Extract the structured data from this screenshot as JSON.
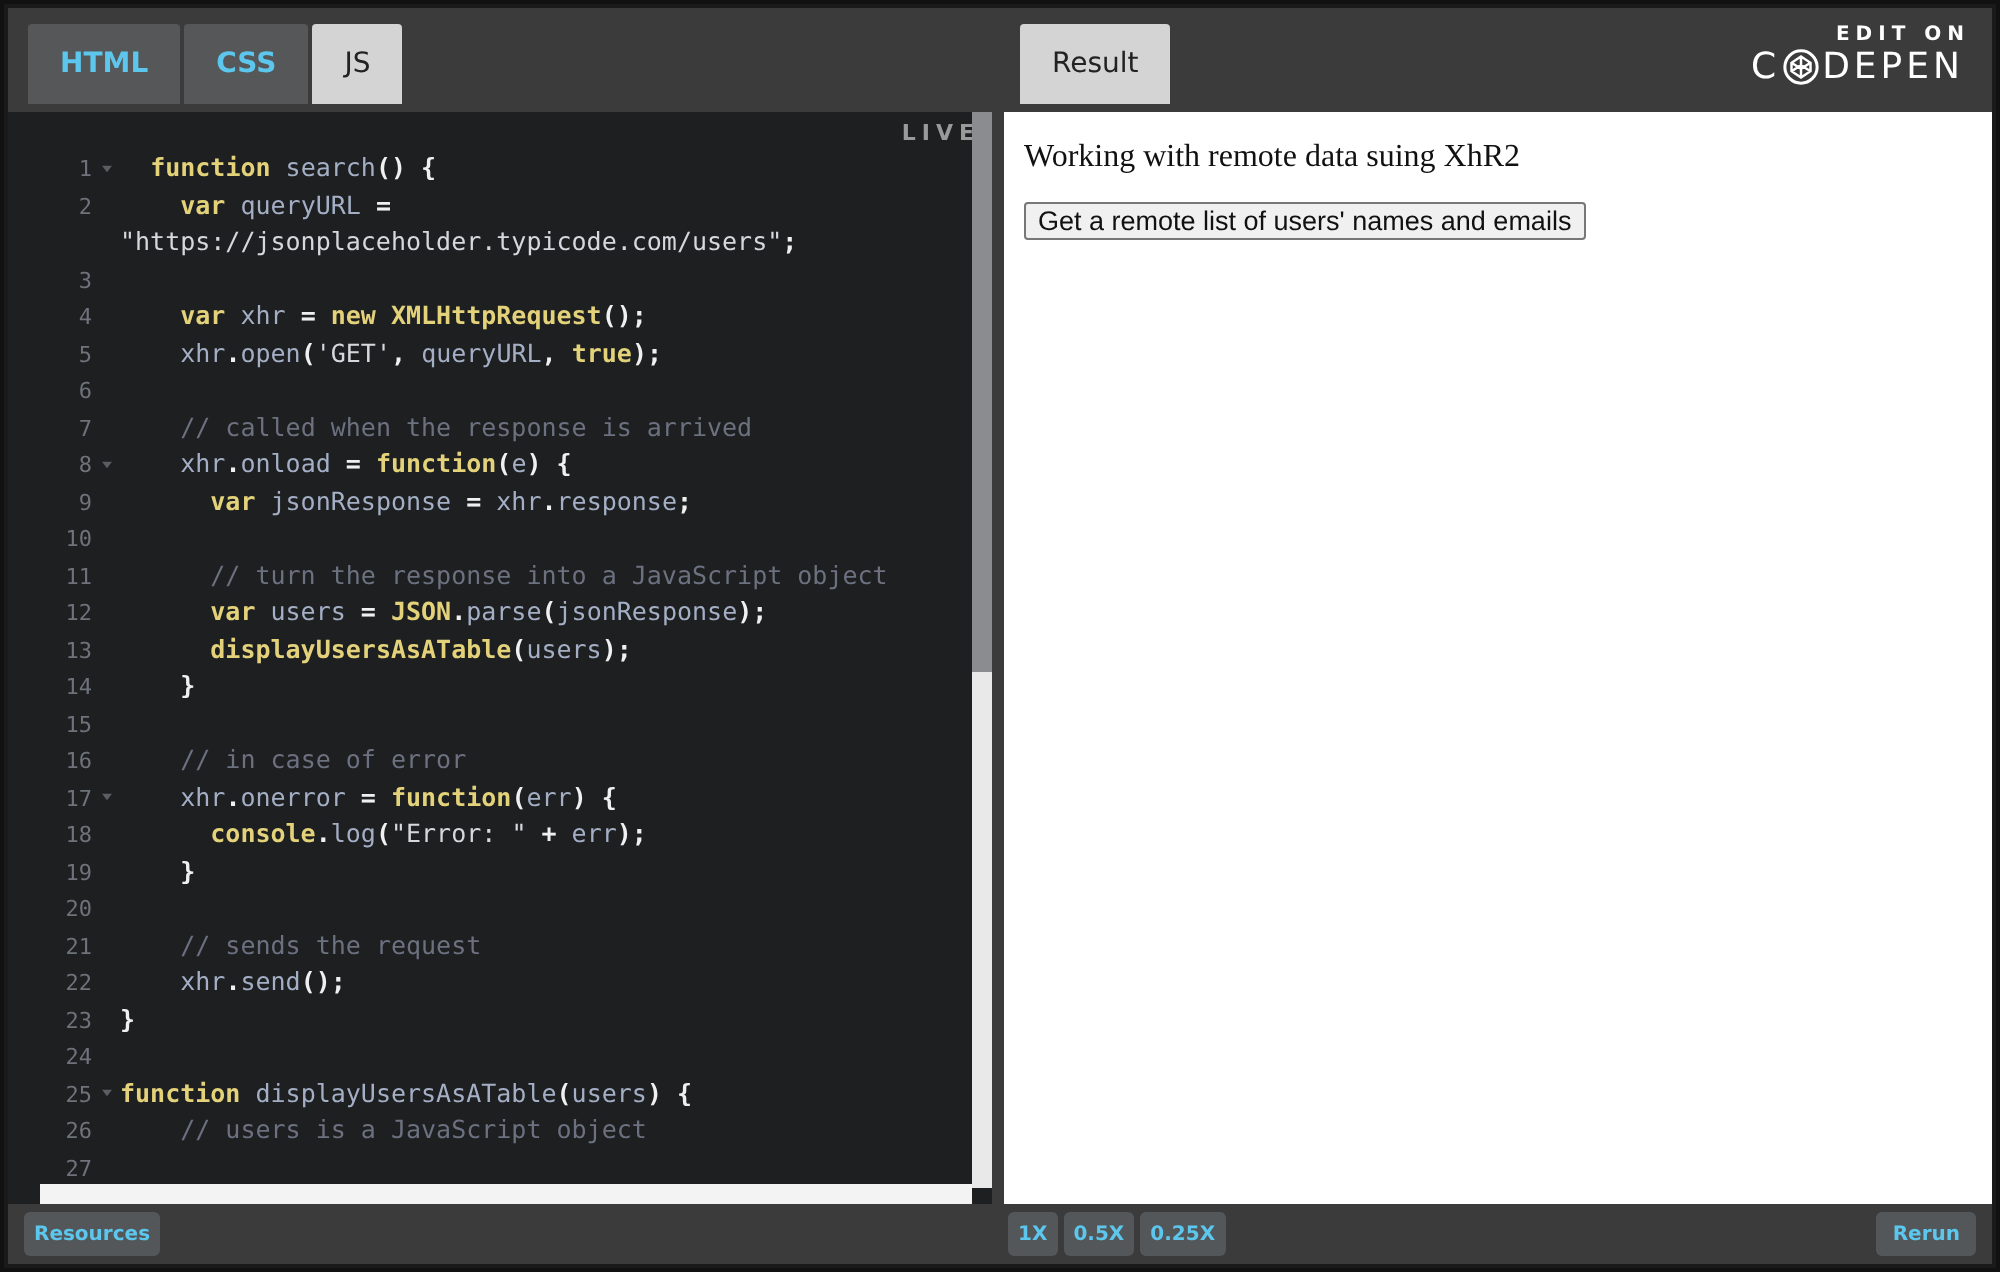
{
  "editor_tabs": [
    {
      "label": "HTML",
      "selected": false
    },
    {
      "label": "CSS",
      "selected": false
    },
    {
      "label": "JS",
      "selected": true
    }
  ],
  "live_badge": "LIVE",
  "code_lines": [
    {
      "number": "1",
      "fold": true,
      "tokens": [
        {
          "kind": "kw",
          "text": "  function"
        },
        {
          "kind": "id",
          "text": " search"
        },
        {
          "kind": "p",
          "text": "() {"
        }
      ]
    },
    {
      "number": "2",
      "fold": false,
      "tokens": [
        {
          "kind": "kw",
          "text": "    var"
        },
        {
          "kind": "id",
          "text": " queryURL"
        },
        {
          "kind": "p",
          "text": " ="
        }
      ]
    },
    {
      "fold": false,
      "tokens": [
        {
          "kind": "str",
          "text": "\"https://jsonplaceholder.typicode.com/users\""
        },
        {
          "kind": "p",
          "text": ";"
        }
      ]
    },
    {
      "number": "3",
      "fold": false
    },
    {
      "number": "4",
      "fold": false,
      "tokens": [
        {
          "kind": "kw",
          "text": "    var"
        },
        {
          "kind": "id",
          "text": " xhr"
        },
        {
          "kind": "p",
          "text": " = "
        },
        {
          "kind": "kw",
          "text": "new"
        },
        {
          "kind": "fn",
          "text": " XMLHttpRequest"
        },
        {
          "kind": "p",
          "text": "();"
        }
      ]
    },
    {
      "number": "5",
      "fold": false,
      "tokens": [
        {
          "kind": "id",
          "text": "    xhr"
        },
        {
          "kind": "p",
          "text": "."
        },
        {
          "kind": "id",
          "text": "open"
        },
        {
          "kind": "p",
          "text": "("
        },
        {
          "kind": "str",
          "text": "'GET'"
        },
        {
          "kind": "p",
          "text": ", "
        },
        {
          "kind": "id",
          "text": "queryURL"
        },
        {
          "kind": "p",
          "text": ", "
        },
        {
          "kind": "kw",
          "text": "true"
        },
        {
          "kind": "p",
          "text": ");"
        }
      ]
    },
    {
      "number": "6",
      "fold": false
    },
    {
      "number": "7",
      "fold": false,
      "tokens": [
        {
          "kind": "cm",
          "text": "    // called when the response is arrived"
        }
      ]
    },
    {
      "number": "8",
      "fold": true,
      "tokens": [
        {
          "kind": "id",
          "text": "    xhr"
        },
        {
          "kind": "p",
          "text": "."
        },
        {
          "kind": "id",
          "text": "onload"
        },
        {
          "kind": "p",
          "text": " = "
        },
        {
          "kind": "kw",
          "text": "function"
        },
        {
          "kind": "p",
          "text": "("
        },
        {
          "kind": "id",
          "text": "e"
        },
        {
          "kind": "p",
          "text": ") {"
        }
      ]
    },
    {
      "number": "9",
      "fold": false,
      "tokens": [
        {
          "kind": "kw",
          "text": "      var"
        },
        {
          "kind": "id",
          "text": " jsonResponse"
        },
        {
          "kind": "p",
          "text": " = "
        },
        {
          "kind": "id",
          "text": "xhr"
        },
        {
          "kind": "p",
          "text": "."
        },
        {
          "kind": "id",
          "text": "response"
        },
        {
          "kind": "p",
          "text": ";"
        }
      ]
    },
    {
      "number": "10",
      "fold": false
    },
    {
      "number": "11",
      "fold": false,
      "tokens": [
        {
          "kind": "cm",
          "text": "      // turn the response into a JavaScript object"
        }
      ]
    },
    {
      "number": "12",
      "fold": false,
      "tokens": [
        {
          "kind": "kw",
          "text": "      var"
        },
        {
          "kind": "id",
          "text": " users"
        },
        {
          "kind": "p",
          "text": " = "
        },
        {
          "kind": "fn",
          "text": "JSON"
        },
        {
          "kind": "p",
          "text": "."
        },
        {
          "kind": "id",
          "text": "parse"
        },
        {
          "kind": "p",
          "text": "("
        },
        {
          "kind": "id",
          "text": "jsonResponse"
        },
        {
          "kind": "p",
          "text": ");"
        }
      ]
    },
    {
      "number": "13",
      "fold": false,
      "tokens": [
        {
          "kind": "fn",
          "text": "      displayUsersAsATable"
        },
        {
          "kind": "p",
          "text": "("
        },
        {
          "kind": "id",
          "text": "users"
        },
        {
          "kind": "p",
          "text": ");"
        }
      ]
    },
    {
      "number": "14",
      "fold": false,
      "tokens": [
        {
          "kind": "p",
          "text": "    }"
        }
      ]
    },
    {
      "number": "15",
      "fold": false
    },
    {
      "number": "16",
      "fold": false,
      "tokens": [
        {
          "kind": "cm",
          "text": "    // in case of error"
        }
      ]
    },
    {
      "number": "17",
      "fold": true,
      "tokens": [
        {
          "kind": "id",
          "text": "    xhr"
        },
        {
          "kind": "p",
          "text": "."
        },
        {
          "kind": "id",
          "text": "onerror"
        },
        {
          "kind": "p",
          "text": " = "
        },
        {
          "kind": "kw",
          "text": "function"
        },
        {
          "kind": "p",
          "text": "("
        },
        {
          "kind": "id",
          "text": "err"
        },
        {
          "kind": "p",
          "text": ") {"
        }
      ]
    },
    {
      "number": "18",
      "fold": false,
      "tokens": [
        {
          "kind": "fn",
          "text": "      console"
        },
        {
          "kind": "p",
          "text": "."
        },
        {
          "kind": "id",
          "text": "log"
        },
        {
          "kind": "p",
          "text": "("
        },
        {
          "kind": "str",
          "text": "\"Error: \""
        },
        {
          "kind": "p",
          "text": " + "
        },
        {
          "kind": "id",
          "text": "err"
        },
        {
          "kind": "p",
          "text": ");"
        }
      ]
    },
    {
      "number": "19",
      "fold": false,
      "tokens": [
        {
          "kind": "p",
          "text": "    }"
        }
      ]
    },
    {
      "number": "20",
      "fold": false
    },
    {
      "number": "21",
      "fold": false,
      "tokens": [
        {
          "kind": "cm",
          "text": "    // sends the request"
        }
      ]
    },
    {
      "number": "22",
      "fold": false,
      "tokens": [
        {
          "kind": "id",
          "text": "    xhr"
        },
        {
          "kind": "p",
          "text": "."
        },
        {
          "kind": "id",
          "text": "send"
        },
        {
          "kind": "p",
          "text": "();"
        }
      ]
    },
    {
      "number": "23",
      "fold": false,
      "tokens": [
        {
          "kind": "p",
          "text": "}"
        }
      ]
    },
    {
      "number": "24",
      "fold": false
    },
    {
      "number": "25",
      "fold": true,
      "tokens": [
        {
          "kind": "kw",
          "text": "function"
        },
        {
          "kind": "id",
          "text": " displayUsersAsATable"
        },
        {
          "kind": "p",
          "text": "("
        },
        {
          "kind": "id",
          "text": "users"
        },
        {
          "kind": "p",
          "text": ") {"
        }
      ]
    },
    {
      "number": "26",
      "fold": false,
      "tokens": [
        {
          "kind": "cm",
          "text": "    // users is a JavaScript object"
        }
      ]
    },
    {
      "number": "27",
      "fold": false
    }
  ],
  "result_tab": {
    "label": "Result",
    "selected": true
  },
  "codepen_link": {
    "caption": "EDIT ON",
    "logo_left": "C",
    "logo_right": "DEPEN"
  },
  "result": {
    "heading": "Working with remote data suing XhR2",
    "button": "Get a remote list of users' names and emails"
  },
  "footer": {
    "resources": "Resources",
    "zoom": [
      "1X",
      "0.5X",
      "0.25X"
    ],
    "rerun": "Rerun"
  }
}
